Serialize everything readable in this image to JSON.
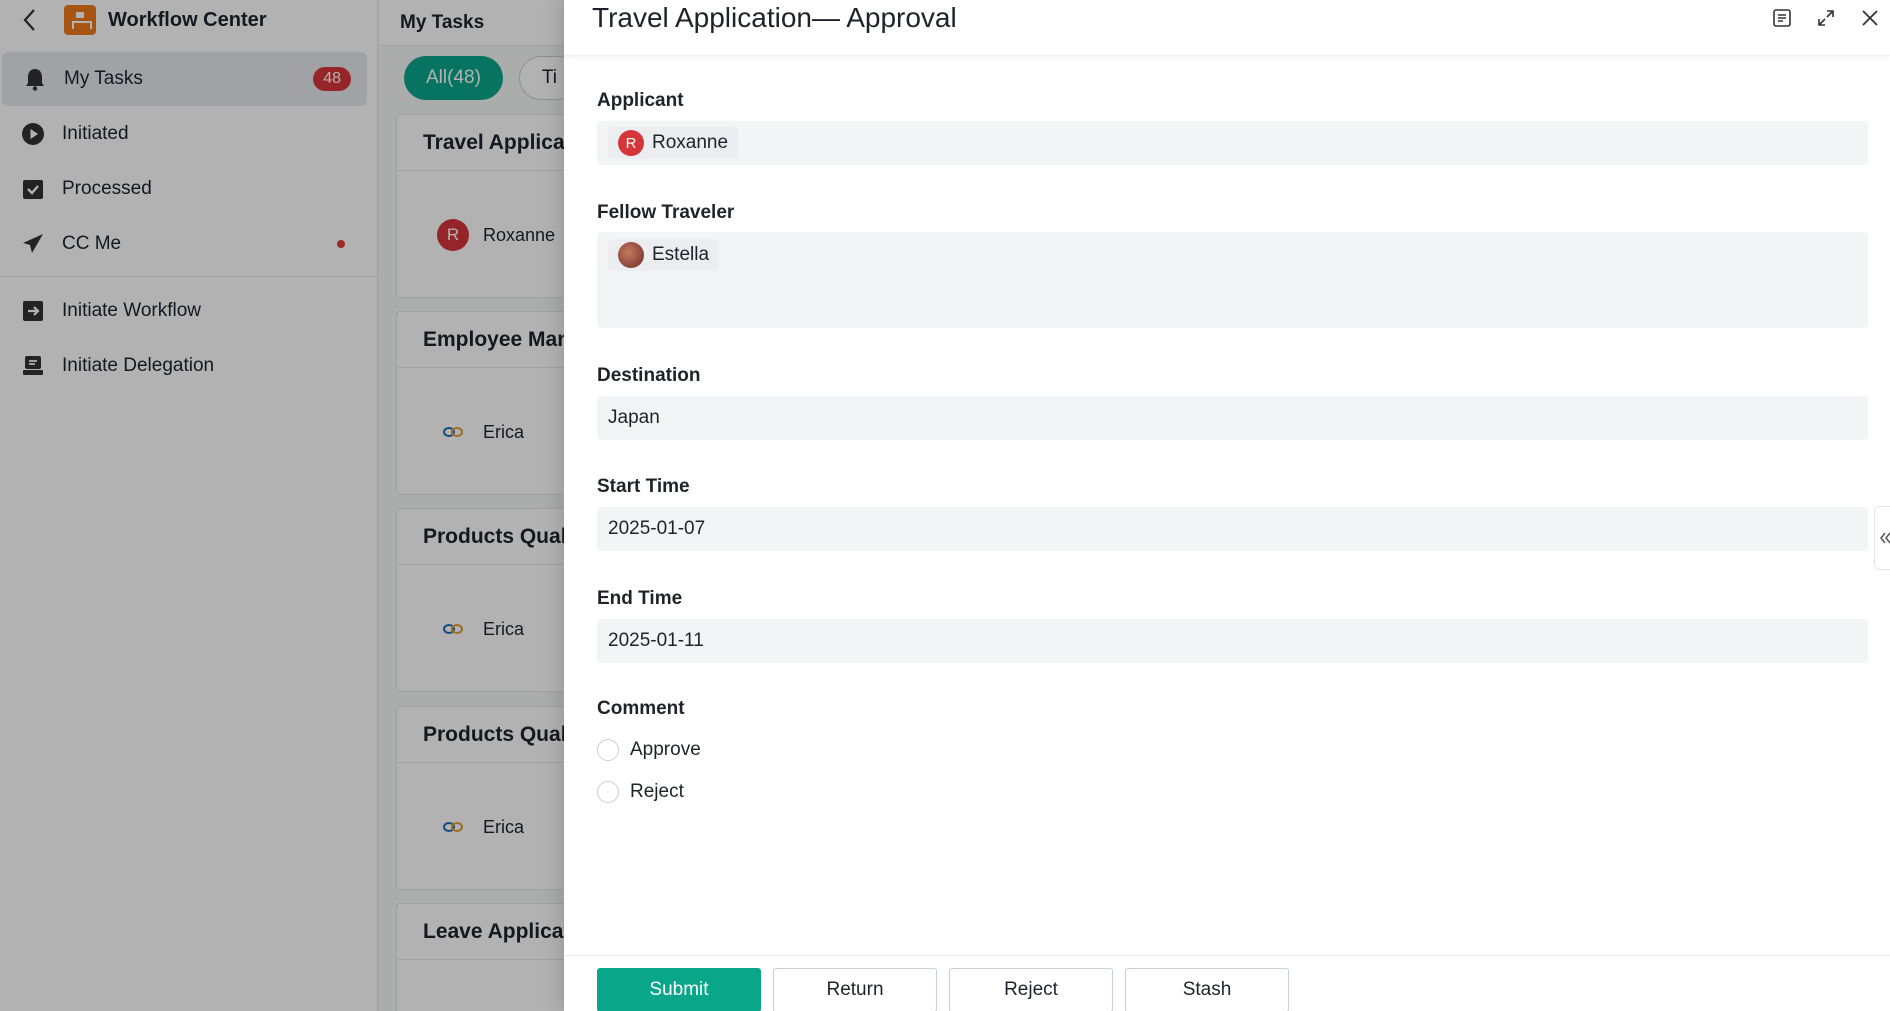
{
  "sidebar": {
    "title": "Workflow Center",
    "items": [
      {
        "label": "My Tasks",
        "badge": "48"
      },
      {
        "label": "Initiated"
      },
      {
        "label": "Processed"
      },
      {
        "label": "CC Me"
      },
      {
        "label": "Initiate Workflow"
      },
      {
        "label": "Initiate Delegation"
      }
    ]
  },
  "list": {
    "header": "My Tasks",
    "filters": [
      "All(48)",
      "Ti"
    ],
    "cards": [
      {
        "title": "Travel Applicati",
        "user": "Roxanne",
        "avatar_letter": "R"
      },
      {
        "title": "Employee Man",
        "user": "Erica"
      },
      {
        "title": "Products Qualit",
        "user": "Erica"
      },
      {
        "title": "Products Qualit",
        "user": "Erica"
      },
      {
        "title": "Leave Applicati"
      }
    ]
  },
  "drawer": {
    "title": "Travel Application— Approval",
    "fields": {
      "applicant": {
        "label": "Applicant",
        "value": "Roxanne",
        "avatar_letter": "R"
      },
      "fellow": {
        "label": "Fellow Traveler",
        "value": "Estella"
      },
      "destination": {
        "label": "Destination",
        "value": "Japan"
      },
      "start": {
        "label": "Start Time",
        "value": "2025-01-07"
      },
      "end": {
        "label": "End Time",
        "value": "2025-01-11"
      },
      "comment": {
        "label": "Comment",
        "options": [
          "Approve",
          "Reject"
        ]
      }
    },
    "buttons": {
      "submit": "Submit",
      "return": "Return",
      "reject": "Reject",
      "stash": "Stash"
    }
  },
  "colors": {
    "accent": "#0aa68a",
    "badge": "#d6353a"
  }
}
